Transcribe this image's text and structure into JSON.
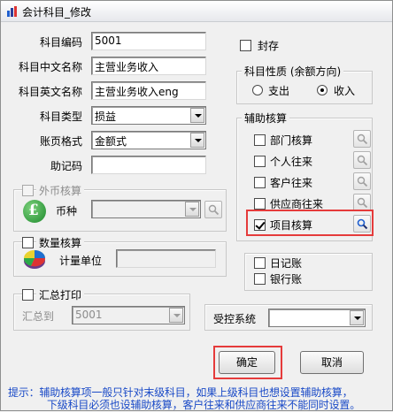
{
  "window": {
    "title": "会计科目_修改"
  },
  "fields": {
    "code_label": "科目编码",
    "code_value": "5001",
    "cn_name_label": "科目中文名称",
    "cn_name_value": "主营业务收入",
    "en_name_label": "科目英文名称",
    "en_name_value": "主营业务收入eng",
    "type_label": "科目类型",
    "type_value": "损益",
    "format_label": "账页格式",
    "format_value": "金额式",
    "mnemonic_label": "助记码",
    "mnemonic_value": ""
  },
  "seal": {
    "label": "封存",
    "checked": false
  },
  "nature": {
    "title": "科目性质 (余额方向)",
    "options": [
      {
        "label": "支出",
        "checked": false
      },
      {
        "label": "收入",
        "checked": true
      }
    ]
  },
  "foreign": {
    "title": "外币核算",
    "currency_label": "币种",
    "currency_value": ""
  },
  "quantity": {
    "title": "数量核算",
    "unit_label": "计量单位",
    "unit_value": ""
  },
  "summary": {
    "title": "汇总打印",
    "to_label": "汇总到",
    "to_value": "5001"
  },
  "aux": {
    "title": "辅助核算",
    "items": [
      {
        "label": "部门核算",
        "checked": false
      },
      {
        "label": "个人往来",
        "checked": false
      },
      {
        "label": "客户往来",
        "checked": false
      },
      {
        "label": "供应商往来",
        "checked": false
      },
      {
        "label": "项目核算",
        "checked": true
      }
    ]
  },
  "books": [
    {
      "label": "日记账",
      "checked": false
    },
    {
      "label": "银行账",
      "checked": false
    }
  ],
  "controlled": {
    "label": "受控系统",
    "value": ""
  },
  "buttons": {
    "ok": "确定",
    "cancel": "取消"
  },
  "hint": {
    "line1": "提示：辅助核算项一般只针对末级科目，如果上级科目也想设置辅助核算，",
    "line2": "下级科目必须也设辅助核算，客户往来和供应商往来不能同时设置。"
  },
  "colors": {
    "highlight": "#e53b3b",
    "hint_text": "#1a4ac7"
  }
}
